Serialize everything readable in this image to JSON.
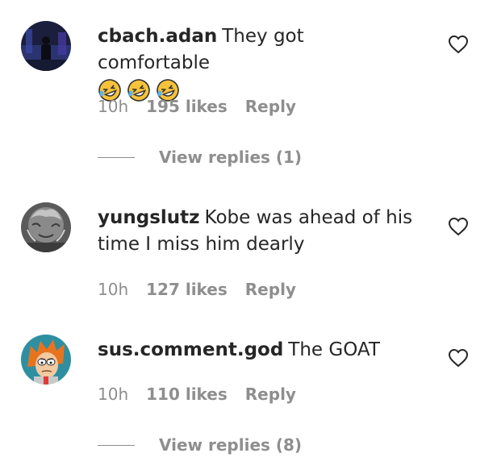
{
  "comments": [
    {
      "username": "cbach.adan",
      "text": "They got comfortable",
      "emoji": [
        "rolling-on-floor-laughing",
        "rolling-on-floor-laughing",
        "rolling-on-floor-laughing"
      ],
      "time": "10h",
      "likes": "195 likes",
      "reply": "Reply",
      "view_replies": "View replies (1)"
    },
    {
      "username": "yungslutz",
      "text": "Kobe was ahead of his time I miss him dearly",
      "time": "10h",
      "likes": "127 likes",
      "reply": "Reply"
    },
    {
      "username": "sus.comment.god",
      "text": "The GOAT",
      "time": "10h",
      "likes": "110 likes",
      "reply": "Reply",
      "view_replies": "View replies (8)"
    }
  ],
  "icons": {
    "like": "heart-outline-icon"
  },
  "colors": {
    "text": "#262626",
    "muted": "#8e8e8e",
    "emoji": "#f7c23b"
  }
}
